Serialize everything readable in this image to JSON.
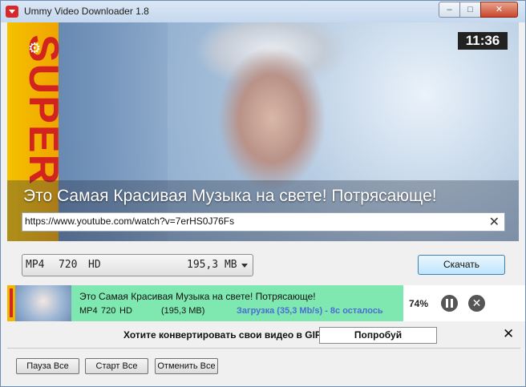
{
  "window": {
    "title": "Ummy Video Downloader 1.8",
    "minimize": "–",
    "maximize": "□",
    "close": "✕"
  },
  "video": {
    "timer": "11:36",
    "title": "Это Самая Красивая Музыка на свете! Потрясающе!",
    "thumbnail_text": "SUPER",
    "url": "https://www.youtube.com/watch?v=7erHS0J76Fs",
    "clear_icon": "✕"
  },
  "format_select": {
    "format": "MP4",
    "quality": "720",
    "hd": "HD",
    "size": "195,3 MB"
  },
  "download_button": "Скачать",
  "download_item": {
    "title": "Это Самая Красивая Музыка на свете! Потрясающе!",
    "format": "MP4",
    "quality": "720",
    "hd": "HD",
    "size": "(195,3 MB)",
    "status": "Загрузка (35,3 Mb/s) - 8с осталось",
    "percent": "74%",
    "progress_fraction": 0.74
  },
  "gif_bar": {
    "text": "Хотите конвертировать свои видео в GIF?",
    "button": "Попробуй",
    "close": "✕"
  },
  "bottom_buttons": {
    "pause_all": "Пауза Все",
    "start_all": "Старт Все",
    "cancel_all": "Отменить Все"
  },
  "colors": {
    "item_background": "#7ee8b0",
    "status_text": "#4b6bd6",
    "timer_background": "#222222"
  }
}
